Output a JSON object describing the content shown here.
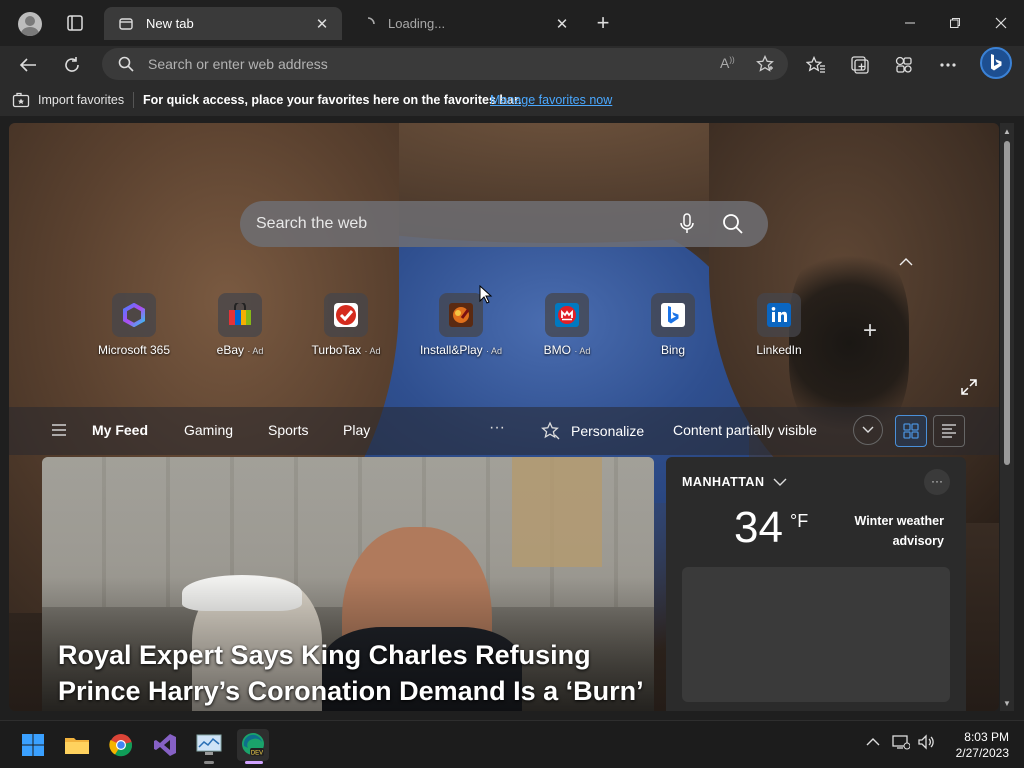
{
  "tabs": [
    {
      "label": "New tab",
      "active": true
    },
    {
      "label": "Loading...",
      "active": false
    }
  ],
  "window_buttons": [
    "minimize-icon",
    "maximize-icon",
    "close-icon"
  ],
  "address_bar": {
    "placeholder": "Search or enter web address"
  },
  "favorites_bar": {
    "import_label": "Import favorites",
    "message": "For quick access, place your favorites here on the favorites bar.",
    "link": "Manage favorites now"
  },
  "newtab": {
    "search_placeholder": "Search the web",
    "quick_links": [
      {
        "name": "Microsoft 365",
        "ad": ""
      },
      {
        "name": "eBay",
        "ad": "· Ad"
      },
      {
        "name": "TurboTax",
        "ad": "· Ad"
      },
      {
        "name": "Install&Play",
        "ad": "· Ad"
      },
      {
        "name": "BMO",
        "ad": "· Ad"
      },
      {
        "name": "Bing",
        "ad": ""
      },
      {
        "name": "LinkedIn",
        "ad": ""
      }
    ],
    "feed_tabs": [
      "My Feed",
      "Gaming",
      "Sports",
      "Play"
    ],
    "more_label": "···",
    "personalize_label": "Personalize",
    "visibility_label": "Content partially visible",
    "hero_headline": "Royal Expert Says King Charles Refusing Prince Harry’s Coronation Demand Is a ‘Burn’",
    "weather": {
      "location": "MANHATTAN",
      "temperature": "34",
      "unit": "°F",
      "condition": "Winter weather advisory",
      "more": "···"
    }
  },
  "taskbar": {
    "time": "8:03 PM",
    "date": "2/27/2023"
  },
  "colors": {
    "accent": "#4aa8ff",
    "frame": "#202020",
    "toolbar": "#2b2b2b"
  }
}
